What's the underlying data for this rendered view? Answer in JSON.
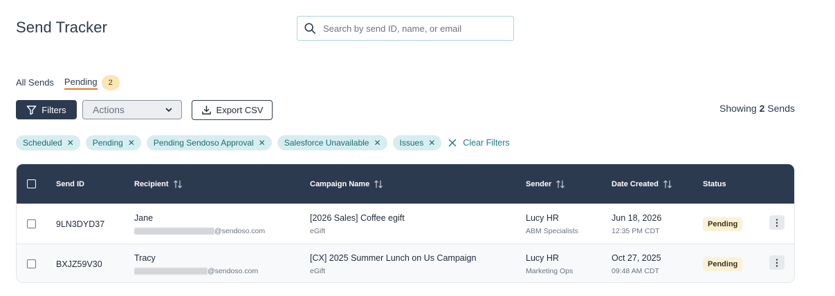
{
  "header": {
    "title": "Send Tracker"
  },
  "search": {
    "placeholder": "Search by send ID, name, or email"
  },
  "tabs": [
    {
      "label": "All Sends",
      "active": false
    },
    {
      "label": "Pending",
      "active": true,
      "badge": "2"
    }
  ],
  "toolbar": {
    "filters_label": "Filters",
    "actions_label": "Actions",
    "export_label": "Export CSV",
    "showing_prefix": "Showing",
    "showing_count": "2",
    "showing_suffix": "Sends"
  },
  "filter_chips": [
    {
      "label": "Scheduled"
    },
    {
      "label": "Pending"
    },
    {
      "label": "Pending Sendoso Approval"
    },
    {
      "label": "Salesforce Unavailable"
    },
    {
      "label": "Issues"
    }
  ],
  "clear_filters_label": "Clear Filters",
  "table": {
    "columns": [
      "Send ID",
      "Recipient",
      "Campaign Name",
      "Sender",
      "Date Created",
      "Status"
    ],
    "rows": [
      {
        "send_id": "9LN3DYD37",
        "recipient_name": "Jane",
        "recipient_email_domain": "@sendoso.com",
        "campaign_name": "[2026 Sales] Coffee egift",
        "campaign_type": "eGift",
        "sender_name": "Lucy HR",
        "sender_team": "ABM Specialists",
        "date": "Jun 18, 2026",
        "time": "12:35 PM CDT",
        "status": "Pending"
      },
      {
        "send_id": "BXJZ59V30",
        "recipient_name": "Tracy",
        "recipient_email_domain": "@sendoso.com",
        "campaign_name": "[CX] 2025 Summer Lunch on Us Campaign",
        "campaign_type": "eGift",
        "sender_name": "Lucy HR",
        "sender_team": "Marketing Ops",
        "date": "Oct 27, 2025",
        "time": "09:48 AM CDT",
        "status": "Pending"
      }
    ]
  },
  "colors": {
    "primary_dark": "#2c3a50",
    "accent_orange": "#e8772e",
    "chip_bg": "#d6eef0",
    "chip_text": "#1d6a74",
    "pending_badge_bg": "#fbf1d6"
  }
}
